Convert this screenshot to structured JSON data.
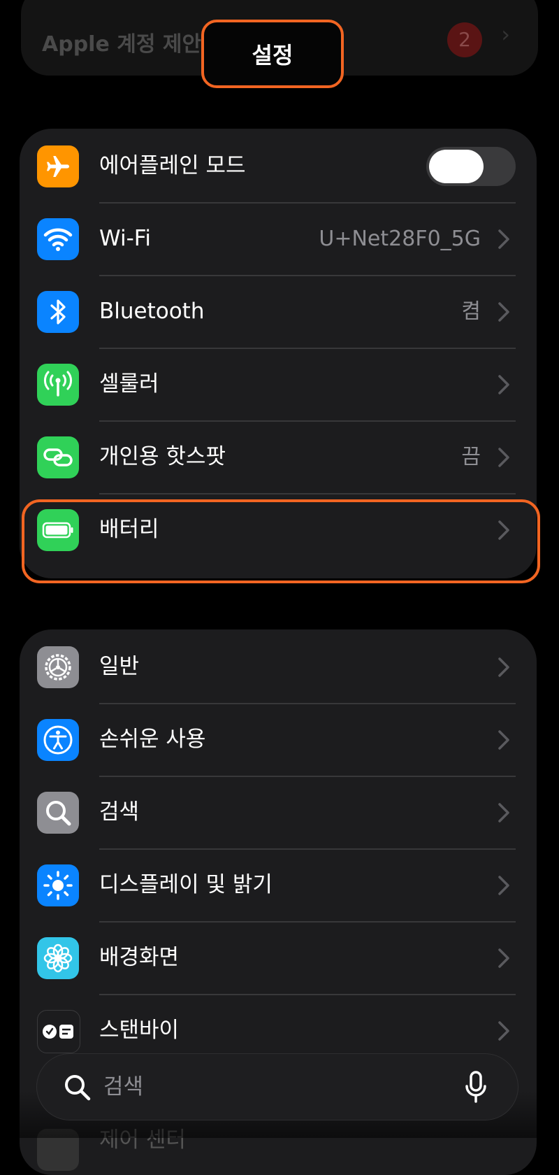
{
  "top_banner": {
    "text": "Apple 계정 제안",
    "badge": "2"
  },
  "page_title": "설정",
  "group1": [
    {
      "id": "airplane",
      "label": "에어플레인 모드",
      "icon": "airplane-icon",
      "color": "#ff9500",
      "control": "toggle",
      "toggle_on": false
    },
    {
      "id": "wifi",
      "label": "Wi-Fi",
      "value": "U+Net28F0_5G",
      "icon": "wifi-icon",
      "color": "#0a84ff"
    },
    {
      "id": "bluetooth",
      "label": "Bluetooth",
      "value": "켬",
      "icon": "bluetooth-icon",
      "color": "#0a84ff"
    },
    {
      "id": "cellular",
      "label": "셀룰러",
      "icon": "antenna-icon",
      "color": "#30d158"
    },
    {
      "id": "hotspot",
      "label": "개인용 핫스팟",
      "value": "끔",
      "icon": "link-icon",
      "color": "#30d158"
    },
    {
      "id": "battery",
      "label": "배터리",
      "icon": "battery-icon",
      "color": "#30d158"
    }
  ],
  "group2": [
    {
      "id": "general",
      "label": "일반",
      "icon": "gear-icon",
      "color": "#8e8e93"
    },
    {
      "id": "accessibility",
      "label": "손쉬운 사용",
      "icon": "accessibility-icon",
      "color": "#0a84ff"
    },
    {
      "id": "search",
      "label": "검색",
      "icon": "search-icon",
      "color": "#8e8e93"
    },
    {
      "id": "display",
      "label": "디스플레이 및 밝기",
      "icon": "sun-icon",
      "color": "#0a84ff"
    },
    {
      "id": "wallpaper",
      "label": "배경화면",
      "icon": "flower-icon",
      "color": "#32c5e8"
    },
    {
      "id": "standby",
      "label": "스탠바이",
      "icon": "standby-icon",
      "color": "#1c1c1e"
    }
  ],
  "faded_row": {
    "label": "제어 센터"
  },
  "search_bar": {
    "placeholder": "검색"
  }
}
